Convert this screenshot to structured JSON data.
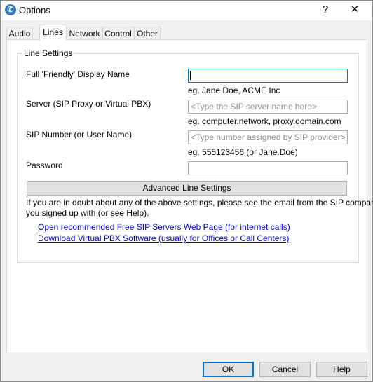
{
  "window": {
    "title": "Options",
    "help_glyph": "?",
    "close_glyph": "✕",
    "icon": "app-logo-icon"
  },
  "tabs": [
    {
      "label": "Audio"
    },
    {
      "label": "Lines"
    },
    {
      "label": "Network"
    },
    {
      "label": "Control"
    },
    {
      "label": "Other"
    }
  ],
  "active_tab": "Lines",
  "line_settings": {
    "group_title": "Line Settings",
    "display_name": {
      "label": "Full 'Friendly' Display Name",
      "value": "",
      "placeholder": "",
      "hint": "eg. Jane Doe, ACME Inc"
    },
    "server": {
      "label": "Server (SIP Proxy or Virtual PBX)",
      "value": "",
      "placeholder": "<Type the SIP server name here>",
      "hint": "eg. computer.network, proxy.domain.com"
    },
    "sip_number": {
      "label": "SIP Number (or User Name)",
      "value": "",
      "placeholder": "<Type number assigned by SIP provider>",
      "hint": "eg. 555123456 (or Jane.Doe)"
    },
    "password": {
      "label": "Password",
      "value": ""
    },
    "advanced_button": "Advanced Line Settings",
    "info_line1": "If you are in doubt about any of the above settings, please see the email from the SIP company",
    "info_line2": "you signed up with (or see Help).",
    "link_servers": "Open recommended Free SIP Servers Web Page (for internet calls)",
    "link_pbx": "Download Virtual PBX Software (usually for Offices or Call Centers)"
  },
  "buttons": {
    "ok": "OK",
    "cancel": "Cancel",
    "help": "Help"
  },
  "colors": {
    "accent": "#0078d7",
    "link": "#0000cc"
  }
}
